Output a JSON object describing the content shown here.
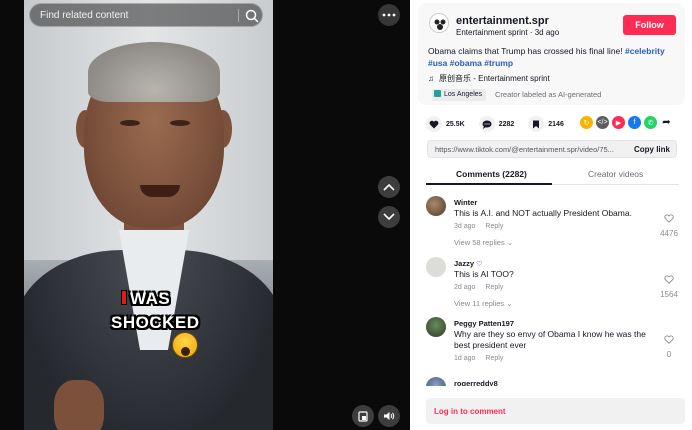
{
  "search": {
    "placeholder": "Find related content"
  },
  "video": {
    "caption_line1": "WAS",
    "caption_line2": "SHOCKED"
  },
  "author": {
    "username": "entertainment.spr",
    "nickname": "Entertainment sprint",
    "posted": "3d ago",
    "follow_label": "Follow"
  },
  "post": {
    "description": "Obama claims that Trump has crossed his final line! ",
    "hashtags": [
      "#celebrity",
      "#usa",
      "#obama",
      "#trump"
    ],
    "music": "原创音乐 - Entertainment sprint",
    "location": "Los Angeles",
    "ai_label": "Creator labeled as AI-generated"
  },
  "stats": {
    "likes": "25.5K",
    "comments": "2282",
    "saves": "2146"
  },
  "share_colors": [
    "#f5b400",
    "#5e5e5e",
    "#fe2c55",
    "#1877f2",
    "#25d366"
  ],
  "link": {
    "url": "https://www.tiktok.com/@entertainment.spr/video/75...",
    "copy_label": "Copy link"
  },
  "tabs": {
    "comments": "Comments (2282)",
    "creator": "Creator videos"
  },
  "comments": [
    {
      "name": "Winter",
      "text": "This is A.I. and NOT actually President Obama.",
      "time": "3d ago",
      "reply": "Reply",
      "likes": "4476",
      "replies": "View 58 replies"
    },
    {
      "name": "Jazzy",
      "text": "This is AI TOO?",
      "time": "2d ago",
      "reply": "Reply",
      "likes": "1564",
      "replies": "View 11 replies"
    },
    {
      "name": "Peggy Patten197",
      "text": "Why are they so envy of Obama I know he was the best president ever",
      "time": "1d ago",
      "reply": "Reply",
      "likes": "0"
    },
    {
      "name": "rogerreddy8"
    }
  ],
  "login": {
    "label": "Log in to comment"
  }
}
